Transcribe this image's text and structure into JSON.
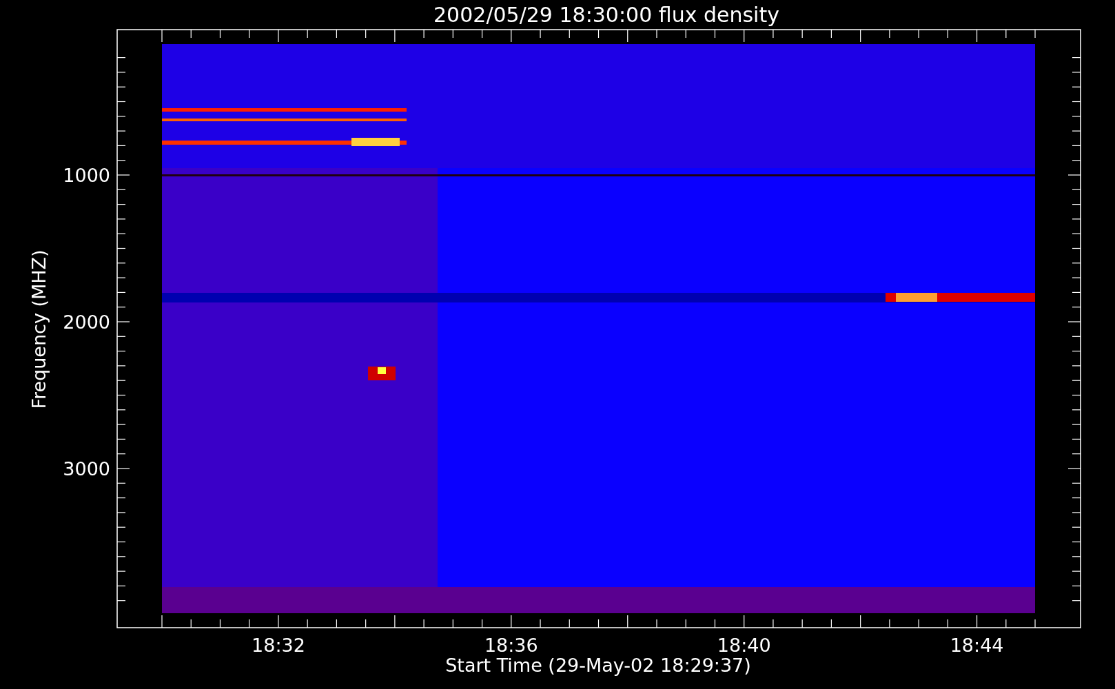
{
  "title": "2002/05/29 18:30:00 flux density",
  "ylabel": "Frequency (MHZ)",
  "yticks": [
    "1000",
    "2000",
    "3000"
  ],
  "xlabel": "Start Time (29-May-02 18:29:37)",
  "xticks": [
    "18:32",
    "18:36",
    "18:40",
    "18:44"
  ]
}
